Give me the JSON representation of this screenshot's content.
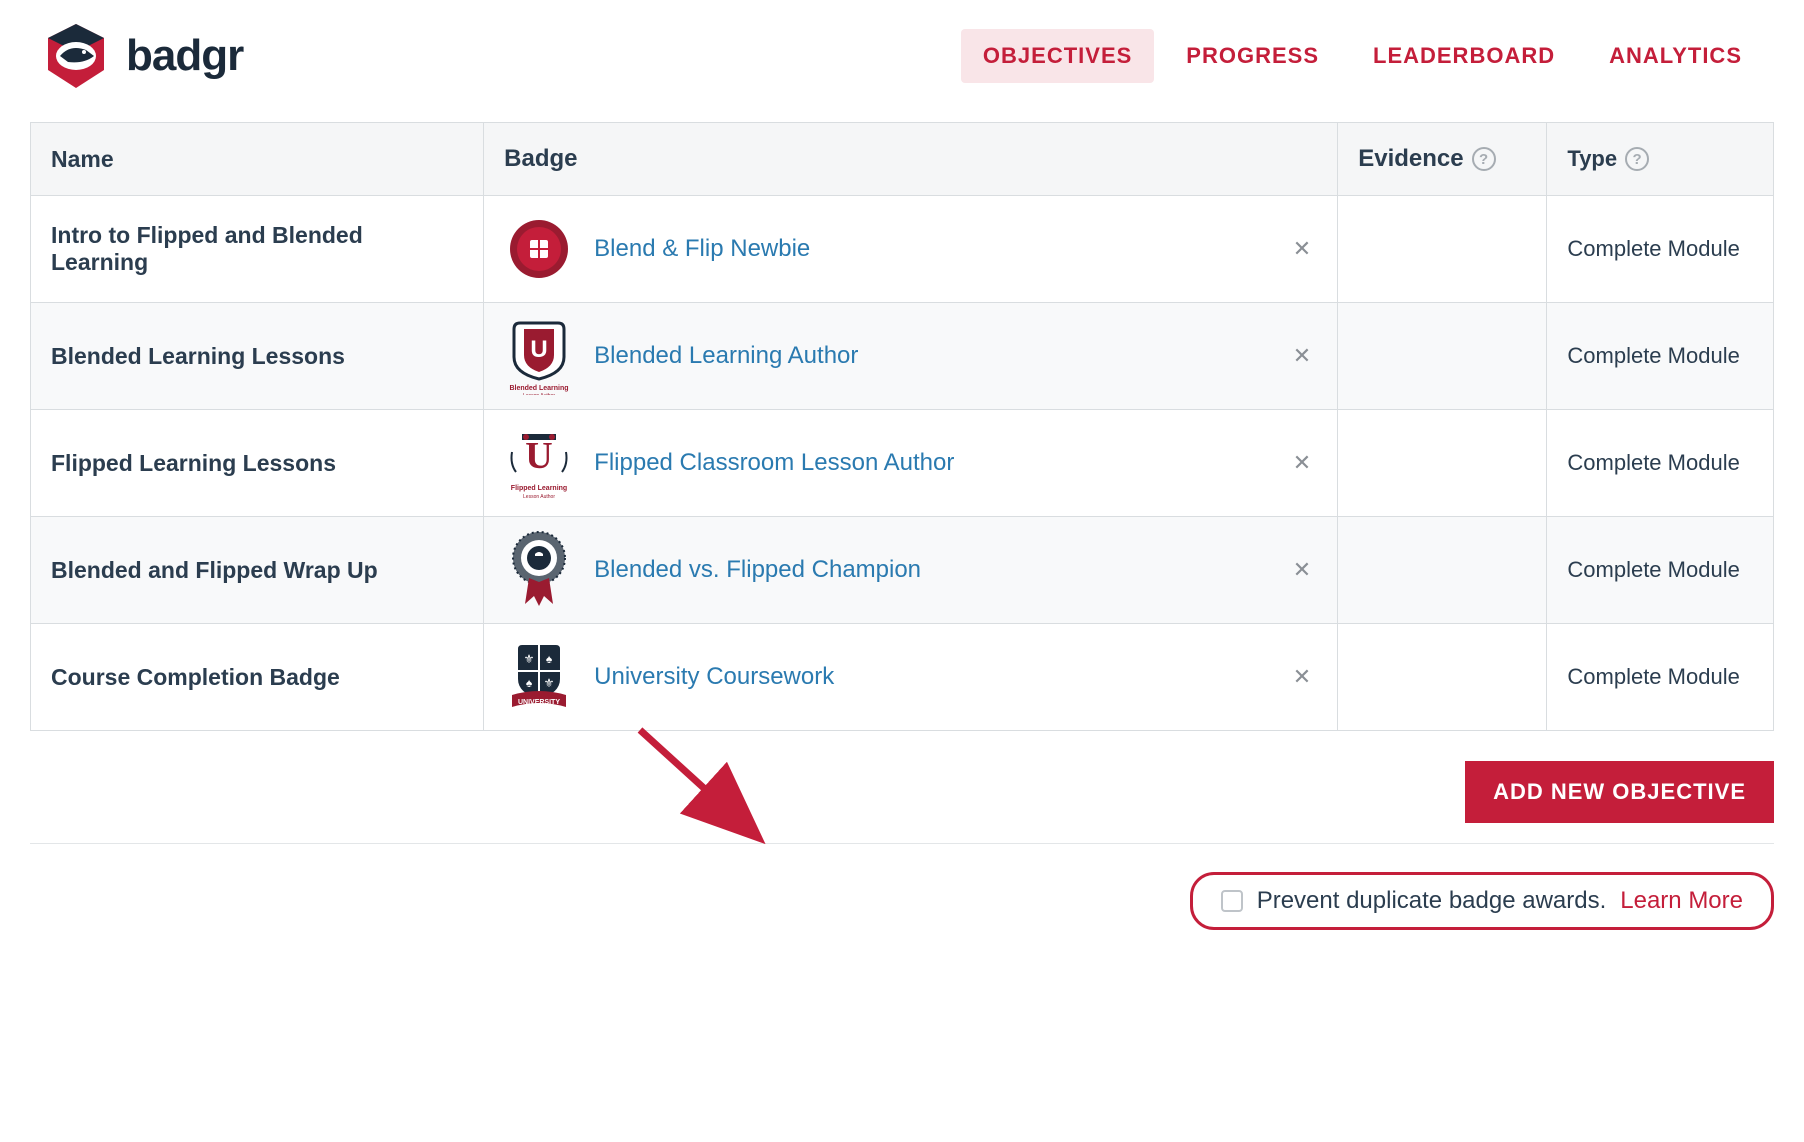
{
  "brand": {
    "name": "badgr"
  },
  "nav": {
    "items": [
      {
        "label": "OBJECTIVES",
        "active": true
      },
      {
        "label": "PROGRESS",
        "active": false
      },
      {
        "label": "LEADERBOARD",
        "active": false
      },
      {
        "label": "ANALYTICS",
        "active": false
      }
    ]
  },
  "table": {
    "headers": {
      "name": "Name",
      "badge": "Badge",
      "evidence": "Evidence",
      "type": "Type"
    },
    "rows": [
      {
        "name": "Intro to Flipped and Blended Learning",
        "badge": "Blend & Flip Newbie",
        "type": "Complete Module"
      },
      {
        "name": "Blended Learning Lessons",
        "badge": "Blended Learning Author",
        "type": "Complete Module"
      },
      {
        "name": "Flipped Learning Lessons",
        "badge": "Flipped Classroom Lesson Author",
        "type": "Complete Module"
      },
      {
        "name": "Blended and Flipped Wrap Up",
        "badge": "Blended vs. Flipped Champion",
        "type": "Complete Module"
      },
      {
        "name": "Course Completion Badge",
        "badge": "University Coursework",
        "type": "Complete Module"
      }
    ]
  },
  "buttons": {
    "add_objective": "ADD NEW OBJECTIVE"
  },
  "prevent": {
    "label": "Prevent duplicate badge awards.",
    "learn_more": "Learn More"
  }
}
